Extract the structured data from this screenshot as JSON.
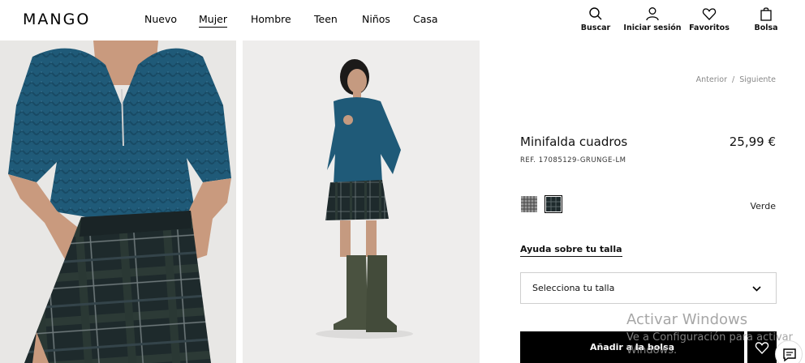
{
  "header": {
    "logo": "MANGO",
    "nav": [
      {
        "label": "Nuevo",
        "active": false
      },
      {
        "label": "Mujer",
        "active": true
      },
      {
        "label": "Hombre",
        "active": false
      },
      {
        "label": "Teen",
        "active": false
      },
      {
        "label": "Niños",
        "active": false
      },
      {
        "label": "Casa",
        "active": false
      }
    ],
    "actions": {
      "search": "Buscar",
      "login": "Iniciar sesión",
      "favorites": "Favoritos",
      "bag": "Bolsa"
    }
  },
  "product": {
    "breadcrumb": {
      "prev": "Anterior",
      "sep": "/",
      "next": "Siguiente"
    },
    "name": "Minifalda cuadros",
    "price": "25,99 €",
    "ref": "REF. 17085129-GRUNGE-LM",
    "color_name": "Verde",
    "swatches": [
      {
        "name": "plaid-light",
        "color": "#8a8a8a"
      },
      {
        "name": "plaid-dark",
        "color": "#1e2a2a",
        "selected": true
      }
    ],
    "size_help": "Ayuda sobre tu talla",
    "size_placeholder": "Selecciona tu talla",
    "add_to_bag": "Añadir a la bolsa"
  },
  "watermark": {
    "line1": "Activar Windows",
    "line2": "Ve a Configuración para activar",
    "line3": "Windows."
  },
  "colors": {
    "sweater": "#1f5a78",
    "skirt": "#1f2a2c",
    "boots": "#4a5240"
  }
}
